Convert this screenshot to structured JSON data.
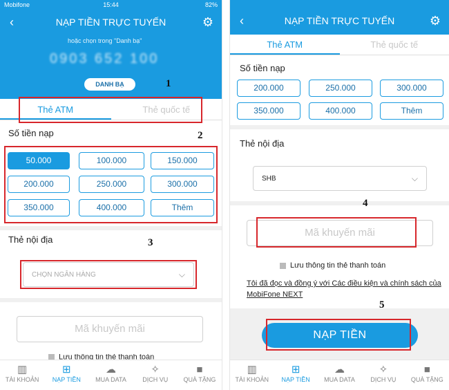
{
  "left": {
    "status": {
      "carrier": "Mobifone",
      "time": "15:44",
      "battery": "82%"
    },
    "header": {
      "title": "NẠP TIỀN TRỰC TUYẾN"
    },
    "hint_text": "hoặc chọn trong \"Danh bạ\"",
    "phone_number": "0903 652 100",
    "contacts_button": "DANH BẠ",
    "tabs": [
      "Thẻ ATM",
      "Thẻ quốc tế"
    ],
    "amount_title": "Số tiền nạp",
    "amounts": [
      "50.000",
      "100.000",
      "150.000",
      "200.000",
      "250.000",
      "300.000",
      "350.000",
      "400.000",
      "Thêm"
    ],
    "bank_title": "Thẻ nội địa",
    "bank_placeholder": "CHỌN NGÂN HÀNG",
    "promo_placeholder": "Mã khuyến mãi",
    "save_card_partial": "Lưu thông tin thẻ thanh toán",
    "annotations": [
      "1",
      "2",
      "3"
    ]
  },
  "right": {
    "header": {
      "title": "NẠP TIỀN TRỰC TUYẾN"
    },
    "tabs": [
      "Thẻ ATM",
      "Thẻ quốc tế"
    ],
    "amount_title": "Số tiền nạp",
    "amounts": [
      "200.000",
      "250.000",
      "300.000",
      "350.000",
      "400.000",
      "Thêm"
    ],
    "bank_title": "Thẻ nội địa",
    "bank_selected": "SHB",
    "promo_placeholder": "Mã khuyến mãi",
    "save_card": "Lưu thông tin thẻ thanh toán",
    "terms": "Tôi đã đọc và đồng ý với Các điều kiện và chính sách của MobiFone NEXT",
    "submit": "NẠP TIỀN",
    "annotations": [
      "4",
      "5"
    ]
  },
  "nav": [
    "TÀI KHOẢN",
    "NẠP TIỀN",
    "MUA DATA",
    "DỊCH VỤ",
    "QUÀ TẶNG"
  ],
  "colors": {
    "accent": "#1a9be0",
    "annotation_box": "#d7262b"
  }
}
